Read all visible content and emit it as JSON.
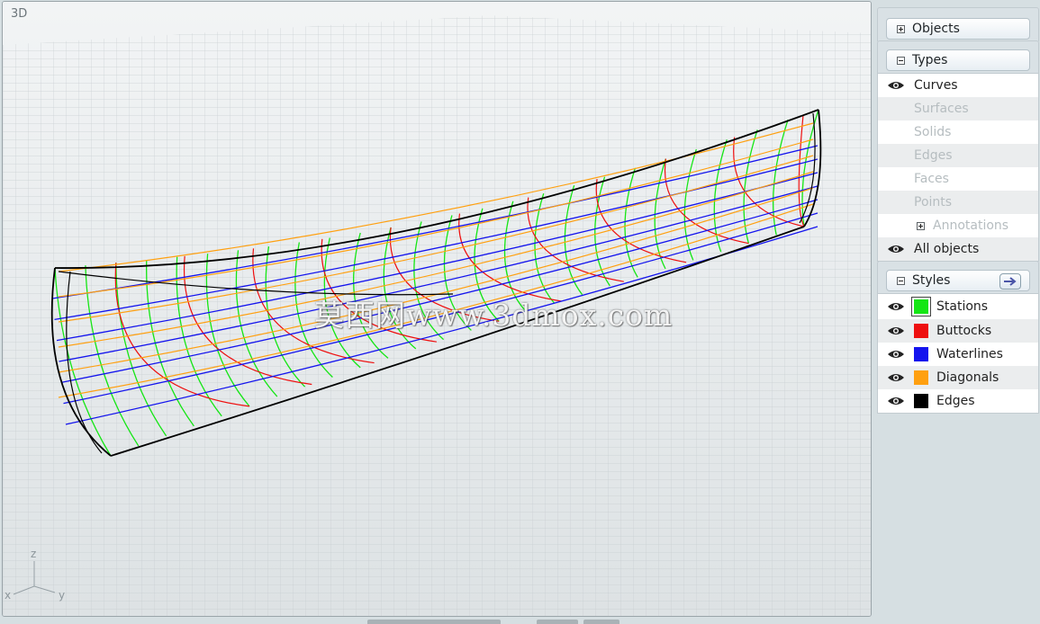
{
  "viewport": {
    "label": "3D",
    "watermark": "莫西网www.3dmox.com",
    "axes": {
      "z": "z",
      "x": "x",
      "y": "y"
    }
  },
  "panel": {
    "objects_header": "Objects",
    "types_header": "Types",
    "styles_header": "Styles",
    "types": [
      {
        "label": "Curves",
        "visible": true,
        "enabled": true
      },
      {
        "label": "Surfaces",
        "enabled": false
      },
      {
        "label": "Solids",
        "enabled": false
      },
      {
        "label": "Edges",
        "enabled": false
      },
      {
        "label": "Faces",
        "enabled": false
      },
      {
        "label": "Points",
        "enabled": false
      },
      {
        "label": "Annotations",
        "enabled": false,
        "expandable": true
      },
      {
        "label": "All objects",
        "visible": true,
        "enabled": true
      }
    ],
    "styles": [
      {
        "label": "Stations",
        "color": "#14e614",
        "visible": true
      },
      {
        "label": "Buttocks",
        "color": "#ee1010",
        "visible": true
      },
      {
        "label": "Waterlines",
        "color": "#1414ee",
        "visible": true
      },
      {
        "label": "Diagonals",
        "color": "#ffa010",
        "visible": true
      },
      {
        "label": "Edges",
        "color": "#000000",
        "visible": true
      }
    ]
  }
}
